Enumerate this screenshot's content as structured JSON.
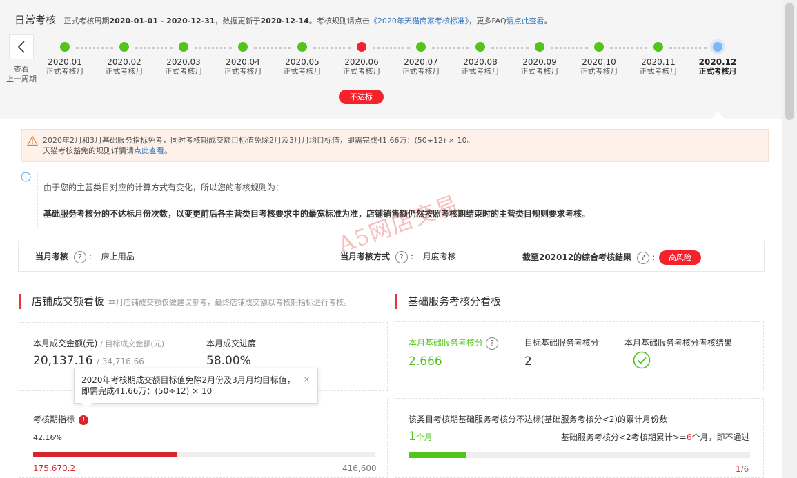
{
  "header": {
    "title": "日常考核",
    "cycle_prefix": "正式考核周期",
    "cycle": "2020-01-01 - 2020-12-31",
    "update_prefix": "，数据更新于",
    "update_date": "2020-12-14",
    "rule_prefix": "。考核规则请点击",
    "rule_link": "《2020年天猫商家考核标准》",
    "faq_prefix": "，更多FAQ",
    "faq_link": "请点此查看",
    "faq_suffix": "。"
  },
  "timeline": {
    "prev_label_line1": "查看",
    "prev_label_line2": "上一周期",
    "months": [
      {
        "month": "2020.01",
        "status": "正式考核月",
        "dot": "green"
      },
      {
        "month": "2020.02",
        "status": "正式考核月",
        "dot": "green"
      },
      {
        "month": "2020.03",
        "status": "正式考核月",
        "dot": "green"
      },
      {
        "month": "2020.04",
        "status": "正式考核月",
        "dot": "green"
      },
      {
        "month": "2020.05",
        "status": "正式考核月",
        "dot": "green"
      },
      {
        "month": "2020.06",
        "status": "正式考核月",
        "dot": "red"
      },
      {
        "month": "2020.07",
        "status": "正式考核月",
        "dot": "green"
      },
      {
        "month": "2020.08",
        "status": "正式考核月",
        "dot": "green"
      },
      {
        "month": "2020.09",
        "status": "正式考核月",
        "dot": "green"
      },
      {
        "month": "2020.10",
        "status": "正式考核月",
        "dot": "green"
      },
      {
        "month": "2020.11",
        "status": "正式考核月",
        "dot": "green"
      },
      {
        "month": "2020.12",
        "status": "正式考核月",
        "dot": "blue"
      }
    ],
    "fail_badge": "不达标"
  },
  "colors": {
    "accent_red": "#f5222d",
    "green": "#52c41a",
    "current_blue": "#7db8f5",
    "link_blue": "#3a7ac0"
  },
  "notice": {
    "line1": "2020年2月和3月基础服务指标免考，同时考核期成交额目标值免除2月及3月月均目标值，即需完成41.66万：(50÷12) × 10。",
    "line2_prefix": "天猫考核豁免的规则详情请",
    "line2_link": "点此查看",
    "line2_suffix": "。"
  },
  "rule": {
    "line1": "由于您的主营类目对应的计算方式有变化，所以您的考核规则为：",
    "line2": "基础服务考核分的不达标月份次数，以变更前后各主营类目考核要求中的最宽标准为准，店铺销售额仍然按照考核期结束时的主营类目规则要求考核。"
  },
  "status": {
    "month_label": "当月考核",
    "month_value": "床上用品",
    "method_label": "当月考核方式",
    "method_value": "月度考核",
    "result_label": "截至202012的综合考核结果",
    "result_badge": "高风险"
  },
  "watermark": "A5网店交易",
  "left_section": {
    "title": "店铺成交额看板",
    "subtitle": "本月店铺成交额仅做建议参考，最终店铺成交额以考核期指标进行考核。",
    "gmv_label": "本月成交金额(元)",
    "target_label": "/ 目标成交金额(元)",
    "gmv_value": "20,137.16",
    "target_value": "/ 34,716.66",
    "progress_label": "本月成交进度",
    "progress_value": "58.00%",
    "tooltip_line1": "2020年考核期成交额目标值免除2月份及3月月均目标值，",
    "tooltip_line2": "即需完成41.66万：(50÷12) × 10",
    "tooltip_close": "×",
    "period_label": "考核期指标",
    "period_percent": "42.16%",
    "period_progress": 0.4216,
    "period_current": "175,670.2",
    "period_target": "416,600"
  },
  "right_section": {
    "title": "基础服务考核分看板",
    "score_label": "本月基础服务考核分",
    "score_value": "2.666",
    "target_label": "目标基础服务考核分",
    "target_value": "2",
    "result_label": "本月基础服务考核分考核结果",
    "count_desc": "该类目考核期基础服务考核分不达标(基础服务考核分<2)的累计月份数",
    "count_value": "1",
    "count_unit": "个月",
    "rule_prefix": "基础服务考核分<2考核期累计>=",
    "rule_highlight": "6",
    "rule_suffix": "个月，即不通过",
    "count_progress": 0.1667,
    "count_current": "1",
    "count_total": "/6"
  },
  "icons": {
    "prev": "chevron-left-icon",
    "warning": "warning-triangle-icon",
    "info": "info-circle-icon",
    "help": "question-circle-icon",
    "check": "check-circle-icon",
    "alert": "exclamation-circle-icon",
    "close": "close-icon"
  }
}
